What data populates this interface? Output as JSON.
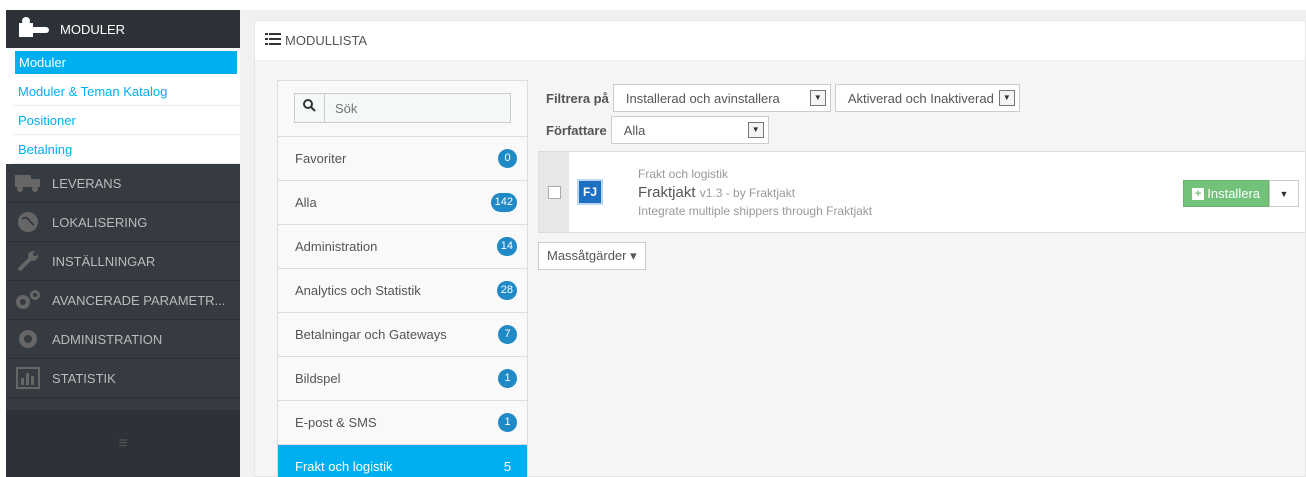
{
  "sidebar": {
    "header": "MODULER",
    "sub_items": [
      {
        "label": "Moduler"
      },
      {
        "label": "Moduler & Teman Katalog"
      },
      {
        "label": "Positioner"
      },
      {
        "label": "Betalning"
      }
    ],
    "main_items": [
      {
        "label": "LEVERANS",
        "icon": "truck-icon"
      },
      {
        "label": "LOKALISERING",
        "icon": "globe-icon"
      },
      {
        "label": "INSTÄLLNINGAR",
        "icon": "wrench-icon"
      },
      {
        "label": "AVANCERADE PARAMETR...",
        "icon": "gears-icon"
      },
      {
        "label": "ADMINISTRATION",
        "icon": "gear-icon"
      },
      {
        "label": "STATISTIK",
        "icon": "bar-chart-icon"
      }
    ],
    "collapse_glyph": "≡"
  },
  "panel": {
    "title": "MODULLISTA"
  },
  "search": {
    "placeholder": "Sök"
  },
  "categories": [
    {
      "label": "Favoriter",
      "count": "0"
    },
    {
      "label": "Alla",
      "count": "142"
    },
    {
      "label": "Administration",
      "count": "14"
    },
    {
      "label": "Analytics och Statistik",
      "count": "28"
    },
    {
      "label": "Betalningar och Gateways",
      "count": "7"
    },
    {
      "label": "Bildspel",
      "count": "1"
    },
    {
      "label": "E-post & SMS",
      "count": "1"
    },
    {
      "label": "Frakt och logistik",
      "count": "5"
    }
  ],
  "filters": {
    "filter_label": "Filtrera på",
    "install_select": "Installerad och avinstallera",
    "active_select": "Aktiverad och Inaktiverad",
    "author_label": "Författare",
    "author_select": "Alla"
  },
  "module": {
    "category": "Frakt och logistik",
    "logo_text": "FJ",
    "name": "Fraktjakt",
    "version": "v1.3 - by Fraktjakt",
    "description": "Integrate multiple shippers through Fraktjakt",
    "install_label": "Installera"
  },
  "bulk": {
    "label": "Massåtgärder ▾"
  },
  "colors": {
    "accent": "#00aff0",
    "sidebar": "#363a41",
    "badge": "#1f8ac6",
    "install": "#72c279"
  }
}
